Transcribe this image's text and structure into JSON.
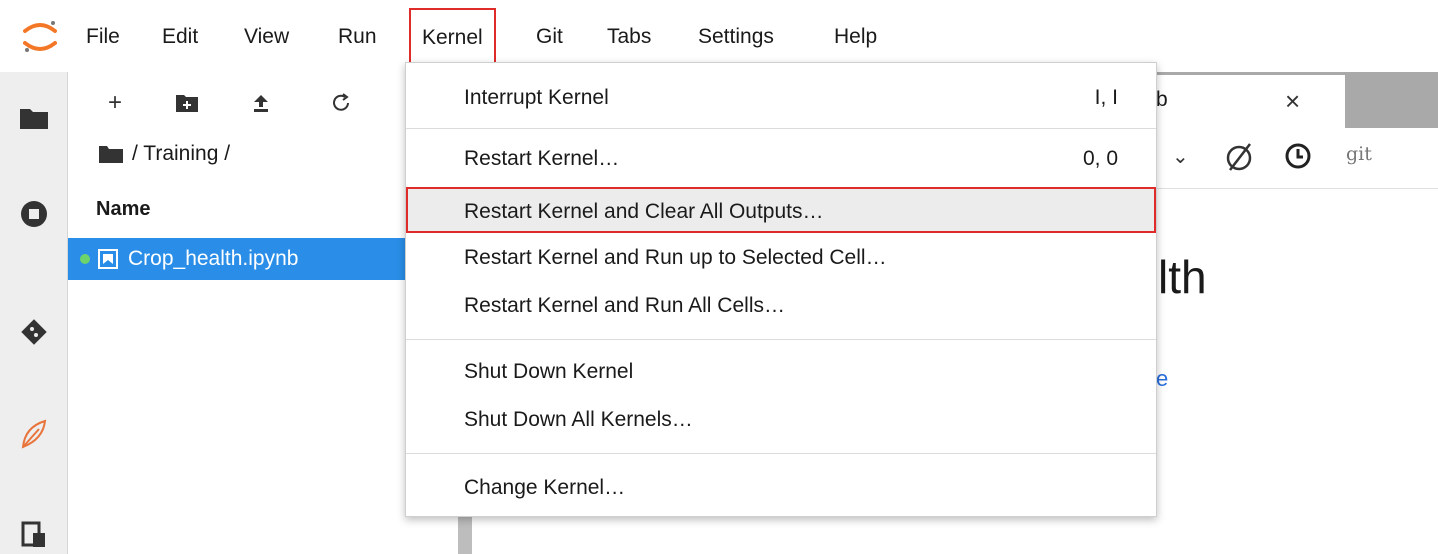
{
  "menubar": {
    "items": [
      "File",
      "Edit",
      "View",
      "Run",
      "Kernel",
      "Git",
      "Tabs",
      "Settings",
      "Help"
    ]
  },
  "filebrowser": {
    "toolbar_icons": [
      "plus-icon",
      "new-folder-icon",
      "upload-icon",
      "refresh-icon"
    ],
    "breadcrumb": "/ Training /",
    "column_header": "Name",
    "files": [
      {
        "name": "Crop_health.ipynb",
        "selected": true,
        "running": true
      }
    ]
  },
  "notebook": {
    "tab_label_fragment": "b",
    "close_glyph": "×",
    "toolbar_git": "git",
    "heading_fragment": "lth",
    "link_fragment": "e"
  },
  "kernel_menu": {
    "items": [
      {
        "label": "Interrupt Kernel",
        "shortcut": "I, I"
      },
      {
        "label": "Restart Kernel…",
        "shortcut": "0, 0"
      },
      {
        "label": "Restart Kernel and Clear All Outputs…",
        "shortcut": ""
      },
      {
        "label": "Restart Kernel and Run up to Selected Cell…",
        "shortcut": ""
      },
      {
        "label": "Restart Kernel and Run All Cells…",
        "shortcut": ""
      },
      {
        "label": "Shut Down Kernel",
        "shortcut": ""
      },
      {
        "label": "Shut Down All Kernels…",
        "shortcut": ""
      },
      {
        "label": "Change Kernel…",
        "shortcut": ""
      }
    ]
  },
  "colors": {
    "accent_blue": "#2a8ee8",
    "highlight_border": "#e02b2b",
    "logo_orange": "#f37726"
  }
}
